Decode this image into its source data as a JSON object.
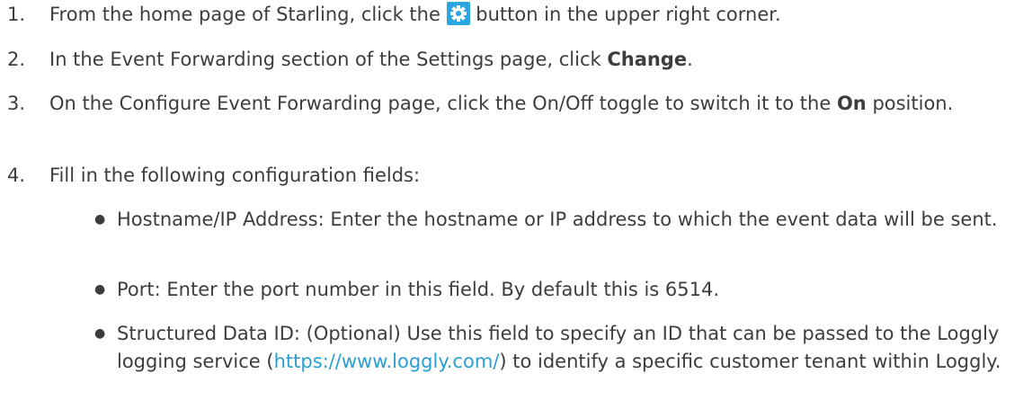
{
  "steps": [
    {
      "num": "1.",
      "text_a": "From the home page of Starling, click the ",
      "icon": "gear-icon",
      "text_b": " button in the upper right corner."
    },
    {
      "num": "2.",
      "text_a": "In the Event Forwarding section of the Settings page, click ",
      "bold": "Change",
      "text_b": "."
    },
    {
      "num": "3.",
      "text_a": "On the Configure Event Forwarding page, click the On/Off toggle to switch it to the ",
      "bold": "On",
      "text_b": " position."
    },
    {
      "num": "4.",
      "text": "Fill in the following configuration fields:"
    }
  ],
  "bullets": [
    {
      "text": "Hostname/IP Address: Enter the hostname or IP address to which the event data will be sent."
    },
    {
      "text": "Port: Enter the port number in this field. By default this is 6514."
    },
    {
      "text_a": "Structured Data ID: (Optional) Use this field to specify an ID that can be passed to the Loggly logging service (",
      "link": "https://www.loggly.com/",
      "text_b": ") to identify a specific customer tenant within Loggly."
    }
  ],
  "colors": {
    "text": "#3d3d3d",
    "link": "#2a9fd6",
    "icon": "#2aa6e0"
  }
}
